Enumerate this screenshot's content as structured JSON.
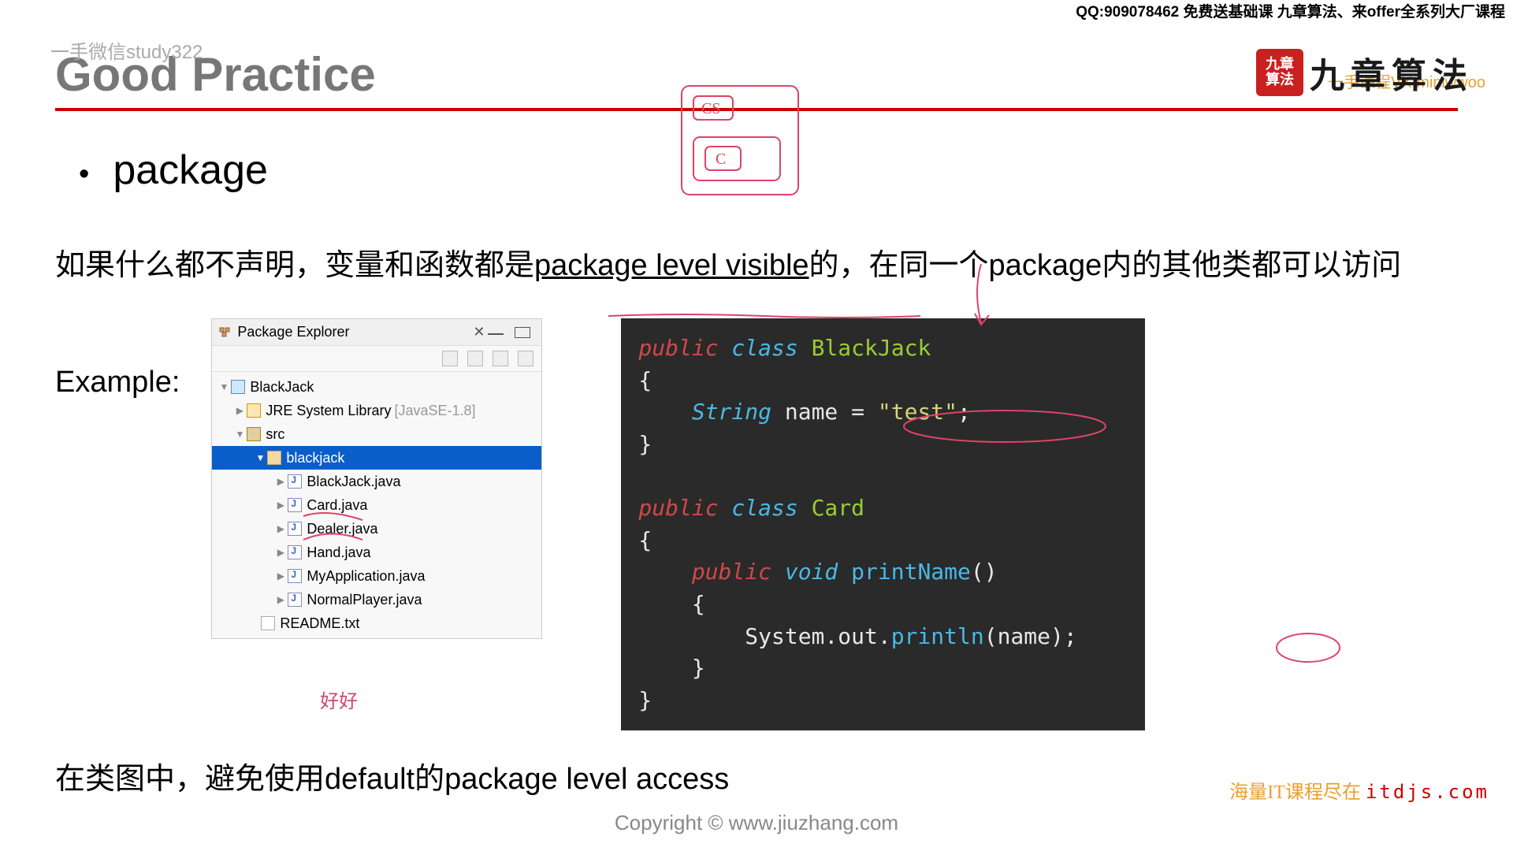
{
  "top_banner": "QQ:909078462 免费送基础课 九章算法、来offer全系列大厂课程",
  "watermark_tl": "一手微信study322",
  "watermark_tr": "一手课程VX:miniwwoo",
  "logo_seal_l1": "九章",
  "logo_seal_l2": "算法",
  "logo_text": "九章算法",
  "slide_title": "Good Practice",
  "bullet": "package",
  "body_p1_a": "如果什么都不声明，变量和函数都是",
  "body_p1_u": "package level visible",
  "body_p1_b": "的，在同一个package内的其他类都可以访问",
  "example_label": "Example:",
  "explorer": {
    "title": "Package Explorer",
    "close": "✕",
    "nodes": {
      "project": "BlackJack",
      "jre": "JRE System Library",
      "jre_ver": "[JavaSE-1.8]",
      "src": "src",
      "pkg": "blackjack",
      "files": [
        "BlackJack.java",
        "Card.java",
        "Dealer.java",
        "Hand.java",
        "MyApplication.java",
        "NormalPlayer.java"
      ],
      "readme": "README.txt"
    }
  },
  "code": {
    "l1_mod": "public",
    "l1_cls": "class",
    "l1_name": "BlackJack",
    "l2": "{",
    "l3_type": "String",
    "l3_id": "name",
    "l3_eq": " = ",
    "l3_str": "\"test\"",
    "l3_semi": ";",
    "l4": "}",
    "l6_mod": "public",
    "l6_cls": "class",
    "l6_name": "Card",
    "l7": "{",
    "l8_mod": "public",
    "l8_void": "void",
    "l8_fn": "printName",
    "l8_par": "()",
    "l9": "{",
    "l10_a": "System.out.",
    "l10_fn": "println",
    "l10_b": "(",
    "l10_arg": "name",
    "l10_c": ");",
    "l11": "}",
    "l12": "}"
  },
  "bottom_text": "在类图中，避免使用default的package level access",
  "copyright": "Copyright © www.jiuzhang.com",
  "watermark_br_a": "海量IT课程尽在",
  "watermark_br_b": "itdjs.com",
  "hand_note": "好好"
}
